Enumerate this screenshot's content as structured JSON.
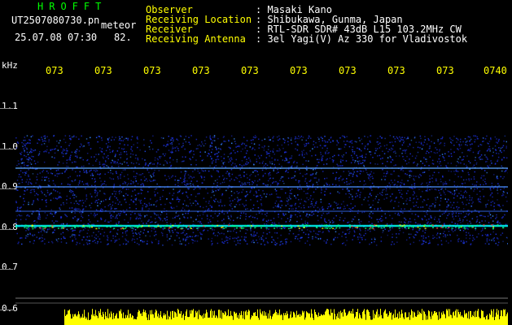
{
  "header": {
    "brand": "HROFFT",
    "filename": "UT2507080730.pn",
    "meteor_label": "meteor",
    "datetime": "25.07.08 07:30",
    "count": "82."
  },
  "info": {
    "observer_label": "Observer",
    "observer_value": ": Masaki Kano",
    "location_label": "Receiving Location",
    "location_value": ": Shibukawa, Gunma, Japan",
    "receiver_label": "Receiver",
    "receiver_value": ": RTL-SDR SDR# 43dB L15 103.2MHz CW",
    "antenna_label": "Receiving Antenna",
    "antenna_value": ": 3el Yagi(V) Az 330 for Vladivostok"
  },
  "time_axis": {
    "ticks": [
      "073",
      "073",
      "073",
      "073",
      "073",
      "073",
      "073",
      "073",
      "073",
      "0740"
    ]
  },
  "freq_axis": {
    "unit": "kHz",
    "labels": [
      "1.1",
      "1.0",
      "0.9",
      "0.8",
      "0.7",
      "0.6"
    ]
  },
  "colors": {
    "background": "#000000",
    "brand": "#00ff00",
    "label": "#ffff00",
    "noise": "#1a2cd0",
    "signal": "#00ffff",
    "spectrum": "#ffff00"
  }
}
